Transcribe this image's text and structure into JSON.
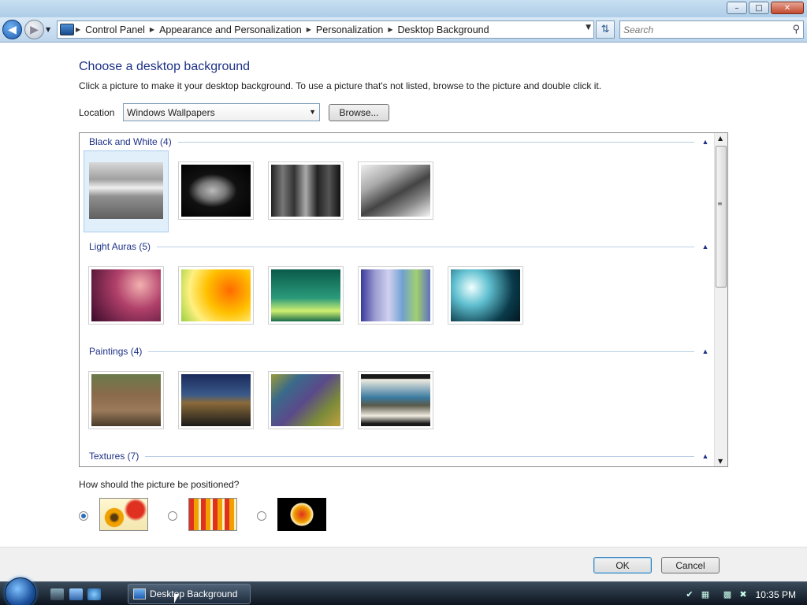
{
  "window": {
    "minimize_glyph": "–",
    "maximize_glyph": "□",
    "close_glyph": "✕"
  },
  "nav": {
    "breadcrumbs": [
      "Control Panel",
      "Appearance and Personalization",
      "Personalization",
      "Desktop Background"
    ],
    "search_placeholder": "Search"
  },
  "main": {
    "title": "Choose a desktop background",
    "subtitle": "Click a picture to make it your desktop background. To use a picture that's not listed, browse to the picture and double click it.",
    "location_label": "Location",
    "location_value": "Windows Wallpapers",
    "browse_label": "Browse...",
    "groups": [
      {
        "label": "Black and White (4)",
        "count": 4
      },
      {
        "label": "Light Auras (5)",
        "count": 5
      },
      {
        "label": "Paintings (4)",
        "count": 4
      },
      {
        "label": "Textures (7)",
        "count": 7
      }
    ],
    "selected_thumbnail": "Black and White 1",
    "position_question": "How should the picture be positioned?",
    "position_options": [
      "fit-to-screen",
      "tile",
      "center"
    ],
    "position_selected": "fit-to-screen"
  },
  "footer": {
    "ok_label": "OK",
    "cancel_label": "Cancel"
  },
  "taskbar": {
    "task_label": "Desktop Background",
    "clock": "10:35 PM"
  }
}
